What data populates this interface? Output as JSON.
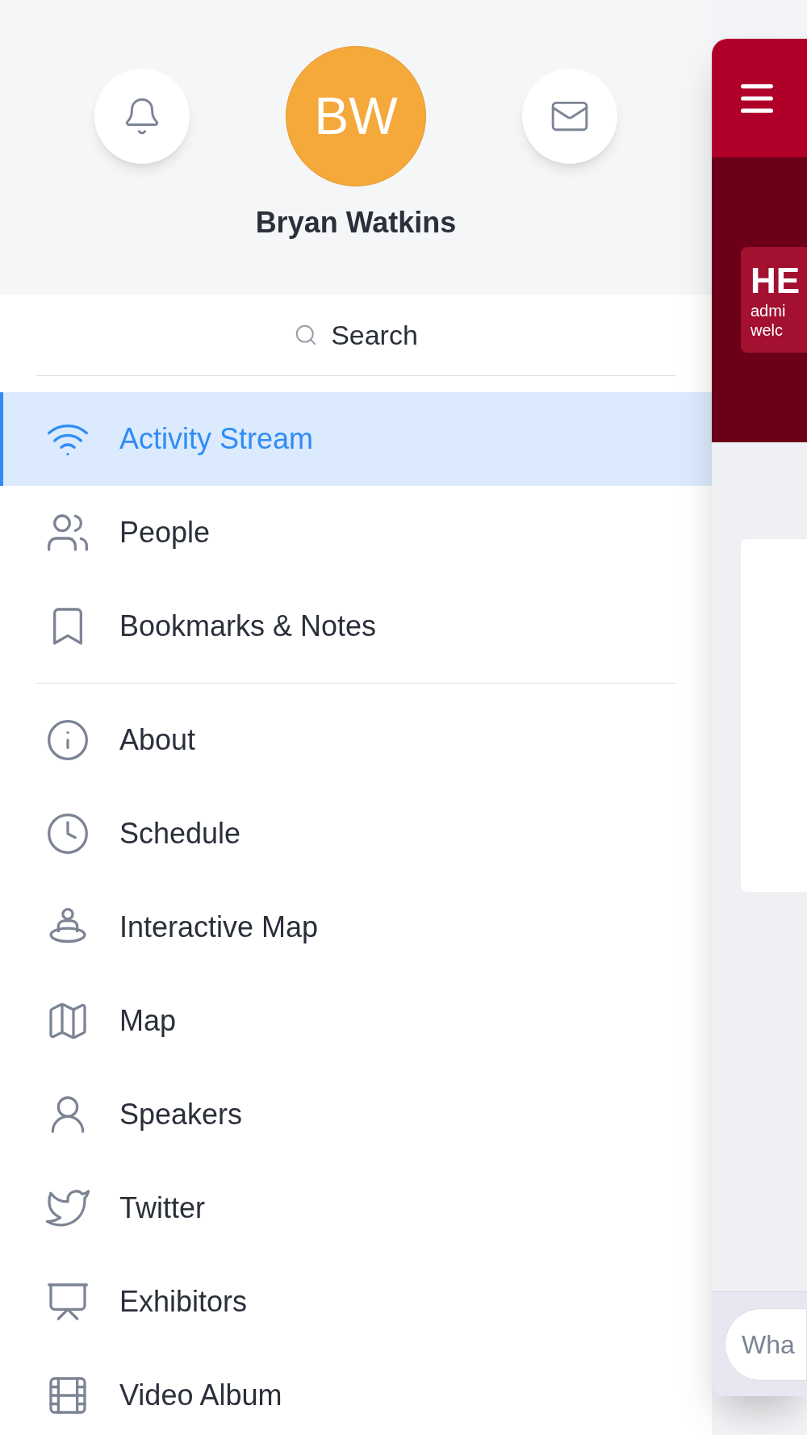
{
  "profile": {
    "initials": "BW",
    "name": "Bryan Watkins"
  },
  "search": {
    "placeholder": "Search"
  },
  "menu_sections": [
    {
      "items": [
        {
          "label": "Activity Stream",
          "selected": true
        },
        {
          "label": "People",
          "selected": false
        },
        {
          "label": "Bookmarks & Notes",
          "selected": false
        }
      ]
    },
    {
      "items": [
        {
          "label": "About",
          "selected": false
        },
        {
          "label": "Schedule",
          "selected": false
        },
        {
          "label": "Interactive Map",
          "selected": false
        },
        {
          "label": "Map",
          "selected": false
        },
        {
          "label": "Speakers",
          "selected": false
        },
        {
          "label": "Twitter",
          "selected": false
        },
        {
          "label": "Exhibitors",
          "selected": false
        },
        {
          "label": "Video Album",
          "selected": false
        }
      ]
    }
  ],
  "app_preview": {
    "banner_title": "HE",
    "banner_lines": [
      "admi",
      "welc"
    ],
    "composer": {
      "placeholder": "Wha"
    }
  }
}
